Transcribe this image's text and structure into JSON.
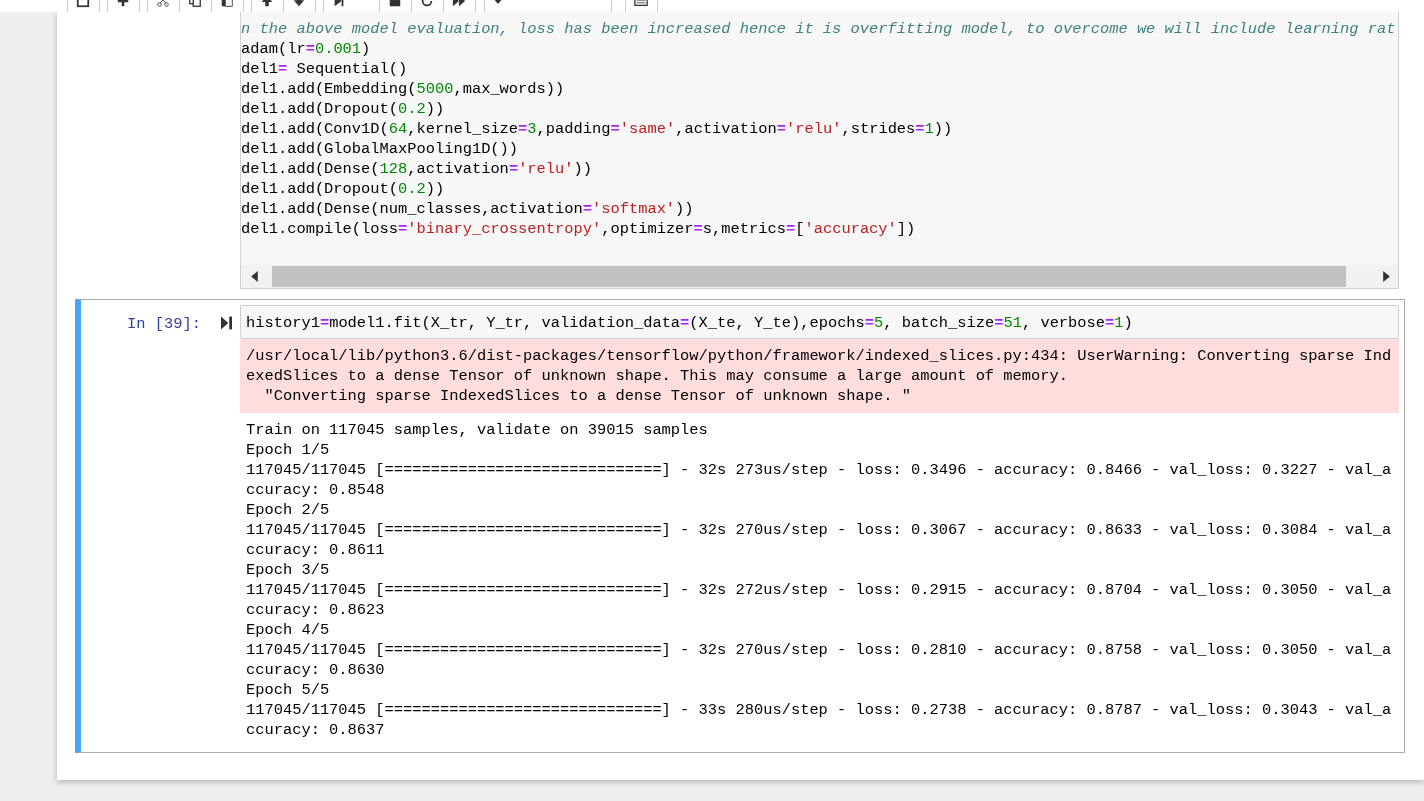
{
  "toolbar": {
    "button_groups": [
      [
        {
          "kind": "save"
        }
      ],
      [
        {
          "kind": "insert"
        }
      ],
      [
        {
          "kind": "cut"
        },
        {
          "kind": "copy"
        },
        {
          "kind": "paste"
        }
      ],
      [
        {
          "kind": "up"
        },
        {
          "kind": "down"
        }
      ],
      [
        {
          "kind": "run"
        },
        {
          "kind": "stop"
        },
        {
          "kind": "restart"
        },
        {
          "kind": "forward"
        }
      ]
    ],
    "cell_type_select": {
      "kind": "dropdown"
    },
    "keyboard_button": {
      "kind": "keyboard"
    }
  },
  "cells": [
    {
      "selected": false,
      "code_lines": [
        [
          {
            "text": "n the above model evaluation, loss has been increased hence it is overfitting model, to overcome we will include learning rat",
            "kind": "comment"
          }
        ],
        [
          {
            "text": "adam(lr",
            "kind": "plain"
          },
          {
            "text": "=",
            "kind": "op"
          },
          {
            "text": "0.001",
            "kind": "num"
          },
          {
            "text": ")",
            "kind": "plain"
          }
        ],
        [
          {
            "text": "del1",
            "kind": "plain"
          },
          {
            "text": "=",
            "kind": "op"
          },
          {
            "text": " Sequential()",
            "kind": "plain"
          }
        ],
        [
          {
            "text": "del1.add(Embedding(",
            "kind": "plain"
          },
          {
            "text": "5000",
            "kind": "num"
          },
          {
            "text": ",max_words))",
            "kind": "plain"
          }
        ],
        [
          {
            "text": "del1.add(Dropout(",
            "kind": "plain"
          },
          {
            "text": "0.2",
            "kind": "num"
          },
          {
            "text": "))",
            "kind": "plain"
          }
        ],
        [
          {
            "text": "del1.add(Conv1D(",
            "kind": "plain"
          },
          {
            "text": "64",
            "kind": "num"
          },
          {
            "text": ",kernel_size",
            "kind": "plain"
          },
          {
            "text": "=",
            "kind": "op"
          },
          {
            "text": "3",
            "kind": "num"
          },
          {
            "text": ",padding",
            "kind": "plain"
          },
          {
            "text": "=",
            "kind": "op"
          },
          {
            "text": "'same'",
            "kind": "str"
          },
          {
            "text": ",activation",
            "kind": "plain"
          },
          {
            "text": "=",
            "kind": "op"
          },
          {
            "text": "'relu'",
            "kind": "str"
          },
          {
            "text": ",strides",
            "kind": "plain"
          },
          {
            "text": "=",
            "kind": "op"
          },
          {
            "text": "1",
            "kind": "num"
          },
          {
            "text": "))",
            "kind": "plain"
          }
        ],
        [
          {
            "text": "del1.add(GlobalMaxPooling1D())",
            "kind": "plain"
          }
        ],
        [
          {
            "text": "del1.add(Dense(",
            "kind": "plain"
          },
          {
            "text": "128",
            "kind": "num"
          },
          {
            "text": ",activation",
            "kind": "plain"
          },
          {
            "text": "=",
            "kind": "op"
          },
          {
            "text": "'relu'",
            "kind": "str"
          },
          {
            "text": "))",
            "kind": "plain"
          }
        ],
        [
          {
            "text": "del1.add(Dropout(",
            "kind": "plain"
          },
          {
            "text": "0.2",
            "kind": "num"
          },
          {
            "text": "))",
            "kind": "plain"
          }
        ],
        [
          {
            "text": "del1.add(Dense(num_classes,activation",
            "kind": "plain"
          },
          {
            "text": "=",
            "kind": "op"
          },
          {
            "text": "'softmax'",
            "kind": "str"
          },
          {
            "text": "))",
            "kind": "plain"
          }
        ],
        [
          {
            "text": "del1.compile(loss",
            "kind": "plain"
          },
          {
            "text": "=",
            "kind": "op"
          },
          {
            "text": "'binary_crossentropy'",
            "kind": "str"
          },
          {
            "text": ",optimizer",
            "kind": "plain"
          },
          {
            "text": "=",
            "kind": "op"
          },
          {
            "text": "s,metrics",
            "kind": "plain"
          },
          {
            "text": "=",
            "kind": "op"
          },
          {
            "text": "[",
            "kind": "plain"
          },
          {
            "text": "'accuracy'",
            "kind": "str"
          },
          {
            "text": "])",
            "kind": "plain"
          }
        ]
      ]
    },
    {
      "selected": true,
      "prompt": "In [39]:",
      "code_lines": [
        [
          {
            "text": "history1",
            "kind": "plain"
          },
          {
            "text": "=",
            "kind": "op"
          },
          {
            "text": "model1.fit(X_tr, Y_tr, validation_data",
            "kind": "plain"
          },
          {
            "text": "=",
            "kind": "op"
          },
          {
            "text": "(X_te, Y_te),epochs",
            "kind": "plain"
          },
          {
            "text": "=",
            "kind": "op"
          },
          {
            "text": "5",
            "kind": "num"
          },
          {
            "text": ", batch_size",
            "kind": "plain"
          },
          {
            "text": "=",
            "kind": "op"
          },
          {
            "text": "51",
            "kind": "num"
          },
          {
            "text": ", verbose",
            "kind": "plain"
          },
          {
            "text": "=",
            "kind": "op"
          },
          {
            "text": "1",
            "kind": "num"
          },
          {
            "text": ")",
            "kind": "plain"
          }
        ]
      ],
      "stderr": [
        "/usr/local/lib/python3.6/dist-packages/tensorflow/python/framework/indexed_slices.py:434: UserWarning: Converting sparse Ind",
        "exedSlices to a dense Tensor of unknown shape. This may consume a large amount of memory.",
        "  \"Converting sparse IndexedSlices to a dense Tensor of unknown shape. \""
      ],
      "stdout": [
        "Train on 117045 samples, validate on 39015 samples",
        "Epoch 1/5",
        "117045/117045 [==============================] - 32s 273us/step - loss: 0.3496 - accuracy: 0.8466 - val_loss: 0.3227 - val_a",
        "ccuracy: 0.8548",
        "Epoch 2/5",
        "117045/117045 [==============================] - 32s 270us/step - loss: 0.3067 - accuracy: 0.8633 - val_loss: 0.3084 - val_a",
        "ccuracy: 0.8611",
        "Epoch 3/5",
        "117045/117045 [==============================] - 32s 272us/step - loss: 0.2915 - accuracy: 0.8704 - val_loss: 0.3050 - val_a",
        "ccuracy: 0.8623",
        "Epoch 4/5",
        "117045/117045 [==============================] - 32s 270us/step - loss: 0.2810 - accuracy: 0.8758 - val_loss: 0.3050 - val_a",
        "ccuracy: 0.8630",
        "Epoch 5/5",
        "117045/117045 [==============================] - 33s 280us/step - loss: 0.2738 - accuracy: 0.8787 - val_loss: 0.3043 - val_a",
        "ccuracy: 0.8637"
      ]
    }
  ]
}
